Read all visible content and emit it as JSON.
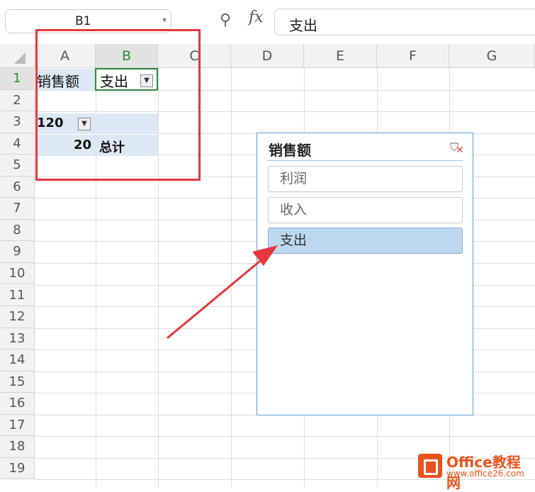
{
  "formula_bar": {
    "name_box": "B1",
    "formula": "支出",
    "zoom_icon": "magnifier-icon",
    "fx_label": "fx"
  },
  "columns": [
    "A",
    "B",
    "C",
    "D",
    "E",
    "F",
    "G"
  ],
  "rows": [
    "1",
    "2",
    "3",
    "4",
    "5",
    "6",
    "7",
    "8",
    "9",
    "10",
    "11",
    "12",
    "13",
    "14",
    "15",
    "16",
    "17",
    "18",
    "19"
  ],
  "cells": {
    "A1": "销售额",
    "B1": "支出",
    "A3": "120",
    "A4": "20",
    "B4": "总计"
  },
  "slicer": {
    "title": "销售额",
    "clear_icon": "clear-filter-icon",
    "items": [
      {
        "label": "利润",
        "selected": false
      },
      {
        "label": "收入",
        "selected": false
      },
      {
        "label": "支出",
        "selected": true
      }
    ]
  },
  "watermark": {
    "name": "Office教程网",
    "url": "www.office26.com"
  },
  "colors": {
    "annotation_red": "#e6373a",
    "selection_green": "#2e8b3e",
    "slicer_selected": "#bdd7ee",
    "pivot_band": "#dde8f5"
  }
}
